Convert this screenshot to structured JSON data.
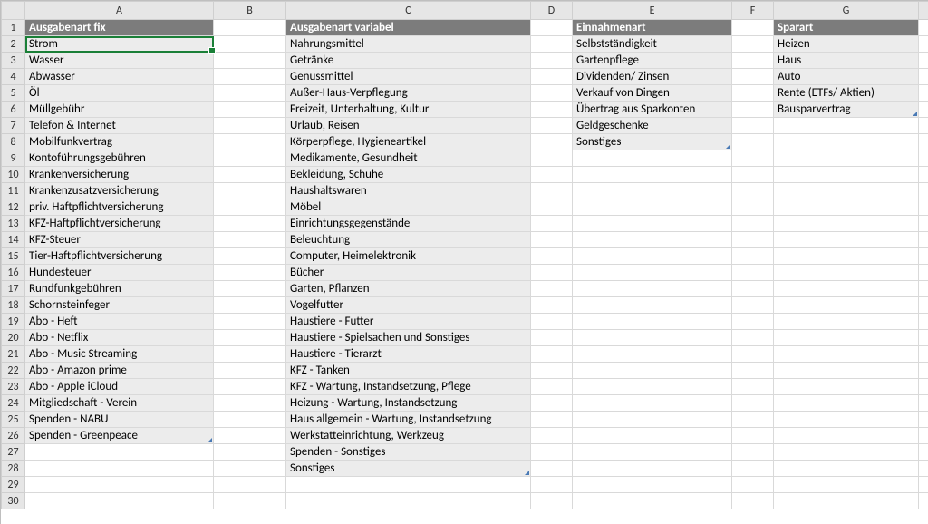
{
  "columns": [
    "A",
    "B",
    "C",
    "D",
    "E",
    "F",
    "G"
  ],
  "row_count": 30,
  "active_cell": "A2",
  "headers": {
    "A": "Ausgabenart fix",
    "C": "Ausgabenart variabel",
    "E": "Einnahmenart",
    "G": "Sparart"
  },
  "data": {
    "A": [
      "Strom",
      "Wasser",
      "Abwasser",
      "Öl",
      "Müllgebühr",
      "Telefon & Internet",
      "Mobilfunkvertrag",
      "Kontoführungsgebühren",
      "Krankenversicherung",
      "Krankenzusatzversicherung",
      "priv. Haftpflichtversicherung",
      "KFZ-Haftpflichtversicherung",
      "KFZ-Steuer",
      "Tier-Haftpflichtversicherung",
      "Hundesteuer",
      "Rundfunkgebühren",
      "Schornsteinfeger",
      "Abo - Heft",
      "Abo - Netflix",
      "Abo - Music Streaming",
      "Abo - Amazon prime",
      "Abo - Apple iCloud",
      "Mitgliedschaft - Verein",
      "Spenden - NABU",
      "Spenden - Greenpeace"
    ],
    "C": [
      "Nahrungsmittel",
      "Getränke",
      "Genussmittel",
      "Außer-Haus-Verpflegung",
      "Freizeit, Unterhaltung, Kultur",
      "Urlaub, Reisen",
      "Körperpflege, Hygieneartikel",
      "Medikamente, Gesundheit",
      "Bekleidung, Schuhe",
      "Haushaltswaren",
      "Möbel",
      "Einrichtungsgegenstände",
      "Beleuchtung",
      "Computer, Heimelektronik",
      "Bücher",
      "Garten, Pflanzen",
      "Vogelfutter",
      "Haustiere - Futter",
      "Haustiere - Spielsachen und Sonstiges",
      "Haustiere - Tierarzt",
      "KFZ - Tanken",
      "KFZ - Wartung, Instandsetzung, Pflege",
      "Heizung - Wartung, Instandsetzung",
      "Haus allgemein - Wartung, Instandsetzung",
      "Werkstatteinrichtung, Werkzeug",
      "Spenden - Sonstiges",
      "Sonstiges"
    ],
    "E": [
      "Selbstständigkeit",
      "Gartenpflege",
      "Dividenden/ Zinsen",
      "Verkauf von Dingen",
      "Übertrag aus Sparkonten",
      "Geldgeschenke",
      "Sonstiges"
    ],
    "G": [
      "Heizen",
      "Haus",
      "Auto",
      "Rente (ETFs/ Aktien)",
      "Bausparvertrag"
    ]
  },
  "indicators": [
    "A26",
    "C28",
    "E8",
    "G6"
  ]
}
